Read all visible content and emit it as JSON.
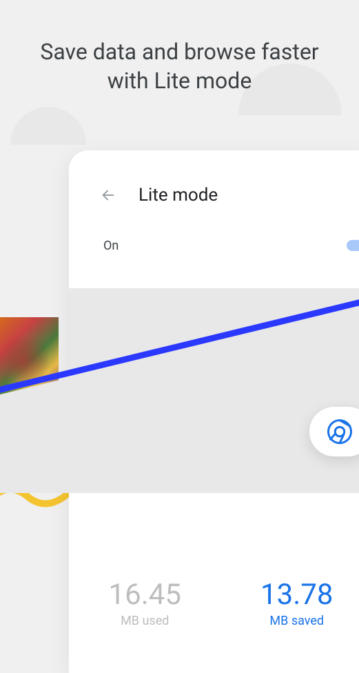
{
  "headline": "Save data and browse faster with Lite mode",
  "card": {
    "title": "Lite mode",
    "toggle_label": "On",
    "toggle_state": true
  },
  "stats": {
    "used_value": "16.45",
    "used_label": "MB used",
    "saved_value": "13.78",
    "saved_label": "MB saved"
  },
  "icons": {
    "back": "back-arrow-icon",
    "chrome": "chrome-icon"
  },
  "colors": {
    "accent": "#1a73e8",
    "muted": "#bdbdbd"
  }
}
